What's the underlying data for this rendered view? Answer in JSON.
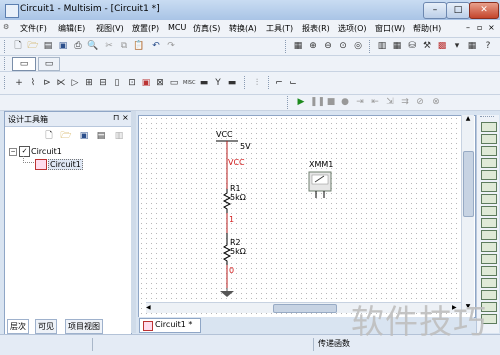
{
  "window": {
    "title": "Circuit1 - Multisim - [Circuit1 *]",
    "controls": {
      "minimize": "–",
      "maximize": "□",
      "close": "✕"
    }
  },
  "menu": [
    {
      "label": "文件(F)"
    },
    {
      "label": "编辑(E)"
    },
    {
      "label": "视图(V)"
    },
    {
      "label": "放置(P)"
    },
    {
      "label": "MCU"
    },
    {
      "label": "仿真(S)"
    },
    {
      "label": "转换(A)"
    },
    {
      "label": "工具(T)"
    },
    {
      "label": "报表(R)"
    },
    {
      "label": "选项(O)"
    },
    {
      "label": "窗口(W)"
    },
    {
      "label": "帮助(H)"
    }
  ],
  "mdi_controls": {
    "minimize": "–",
    "restore": "▫",
    "close": "×"
  },
  "design_toolbox": {
    "title": "设计工具箱",
    "tree": {
      "root": "Circuit1",
      "child": "Circuit1"
    },
    "tabs": [
      "层次",
      "可见",
      "项目视图"
    ]
  },
  "schematic": {
    "vcc_label": "VCC",
    "vcc_value": "5V",
    "vcc_net": "VCC",
    "r1_name": "R1",
    "r1_value": "5kΩ",
    "node_1": "1",
    "r2_name": "R2",
    "r2_value": "5kΩ",
    "node_0": "0",
    "instrument": "XMM1"
  },
  "document_tab": {
    "label": "Circuit1 *"
  },
  "statusbar": {
    "right": "传递函数"
  },
  "watermark": "软件技巧"
}
